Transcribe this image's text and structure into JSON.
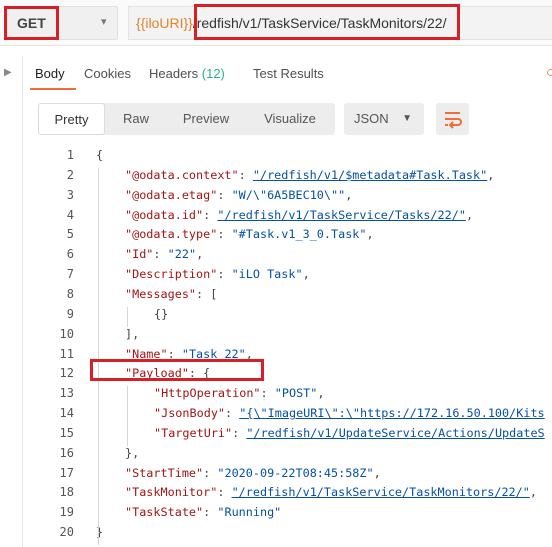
{
  "request": {
    "method": "GET",
    "url_variable": "{{iloURI}}",
    "url_path": "/redfish/v1/TaskService/TaskMonitors/22/"
  },
  "tabs": [
    {
      "label": "Body"
    },
    {
      "label": "Cookies"
    },
    {
      "label": "Headers",
      "count": "(12)"
    },
    {
      "label": "Test Results"
    }
  ],
  "format_buttons": [
    "Pretty",
    "Raw",
    "Preview",
    "Visualize"
  ],
  "language": "JSON",
  "colors": {
    "accent": "#f26b3a",
    "highlight": "#d81f26",
    "key": "#a31515",
    "string": "#0451a5"
  },
  "code_lines": [
    {
      "n": "1",
      "parts": [
        {
          "t": "{",
          "c": "p"
        }
      ]
    },
    {
      "n": "2",
      "parts": [
        {
          "t": "\"@odata.context\"",
          "c": "k"
        },
        {
          "t": ": ",
          "c": "p"
        },
        {
          "t": "\"/redfish/v1/$metadata#Task.Task\"",
          "c": "s u"
        },
        {
          "t": ",",
          "c": "p"
        }
      ]
    },
    {
      "n": "3",
      "parts": [
        {
          "t": "\"@odata.etag\"",
          "c": "k"
        },
        {
          "t": ": ",
          "c": "p"
        },
        {
          "t": "\"W/\\\"6A5BEC10\\\"\"",
          "c": "s"
        },
        {
          "t": ",",
          "c": "p"
        }
      ]
    },
    {
      "n": "4",
      "parts": [
        {
          "t": "\"@odata.id\"",
          "c": "k"
        },
        {
          "t": ": ",
          "c": "p"
        },
        {
          "t": "\"/redfish/v1/TaskService/Tasks/22/\"",
          "c": "s u"
        },
        {
          "t": ",",
          "c": "p"
        }
      ]
    },
    {
      "n": "5",
      "parts": [
        {
          "t": "\"@odata.type\"",
          "c": "k"
        },
        {
          "t": ": ",
          "c": "p"
        },
        {
          "t": "\"#Task.v1_3_0.Task\"",
          "c": "s"
        },
        {
          "t": ",",
          "c": "p"
        }
      ]
    },
    {
      "n": "6",
      "parts": [
        {
          "t": "\"Id\"",
          "c": "k"
        },
        {
          "t": ": ",
          "c": "p"
        },
        {
          "t": "\"22\"",
          "c": "s"
        },
        {
          "t": ",",
          "c": "p"
        }
      ]
    },
    {
      "n": "7",
      "parts": [
        {
          "t": "\"Description\"",
          "c": "k"
        },
        {
          "t": ": ",
          "c": "p"
        },
        {
          "t": "\"iLO Task\"",
          "c": "s"
        },
        {
          "t": ",",
          "c": "p"
        }
      ]
    },
    {
      "n": "8",
      "parts": [
        {
          "t": "\"Messages\"",
          "c": "k"
        },
        {
          "t": ": [",
          "c": "p"
        }
      ]
    },
    {
      "n": "9",
      "parts": [
        {
          "t": "{}",
          "c": "p"
        }
      ]
    },
    {
      "n": "10",
      "parts": [
        {
          "t": "],",
          "c": "p"
        }
      ]
    },
    {
      "n": "11",
      "parts": [
        {
          "t": "\"Name\"",
          "c": "k"
        },
        {
          "t": ": ",
          "c": "p"
        },
        {
          "t": "\"Task 22\"",
          "c": "s"
        },
        {
          "t": ",",
          "c": "p"
        }
      ]
    },
    {
      "n": "12",
      "parts": [
        {
          "t": "\"Payload\"",
          "c": "k"
        },
        {
          "t": ": {",
          "c": "p"
        }
      ]
    },
    {
      "n": "13",
      "parts": [
        {
          "t": "\"HttpOperation\"",
          "c": "k"
        },
        {
          "t": ": ",
          "c": "p"
        },
        {
          "t": "\"POST\"",
          "c": "s"
        },
        {
          "t": ",",
          "c": "p"
        }
      ]
    },
    {
      "n": "14",
      "parts": [
        {
          "t": "\"JsonBody\"",
          "c": "k"
        },
        {
          "t": ": ",
          "c": "p"
        },
        {
          "t": "\"{\\\"ImageURI\\\":\\\"https://172.16.50.100/Kits",
          "c": "s u"
        }
      ]
    },
    {
      "n": "15",
      "parts": [
        {
          "t": "\"TargetUri\"",
          "c": "k"
        },
        {
          "t": ": ",
          "c": "p"
        },
        {
          "t": "\"/redfish/v1/UpdateService/Actions/UpdateS",
          "c": "s u"
        }
      ]
    },
    {
      "n": "16",
      "parts": [
        {
          "t": "},",
          "c": "p"
        }
      ]
    },
    {
      "n": "17",
      "parts": [
        {
          "t": "\"StartTime\"",
          "c": "k"
        },
        {
          "t": ": ",
          "c": "p"
        },
        {
          "t": "\"2020-09-22T08:45:58Z\"",
          "c": "s"
        },
        {
          "t": ",",
          "c": "p"
        }
      ]
    },
    {
      "n": "18",
      "parts": [
        {
          "t": "\"TaskMonitor\"",
          "c": "k"
        },
        {
          "t": ": ",
          "c": "p"
        },
        {
          "t": "\"/redfish/v1/TaskService/TaskMonitors/22/\"",
          "c": "s u"
        },
        {
          "t": ",",
          "c": "p"
        }
      ]
    },
    {
      "n": "19",
      "parts": [
        {
          "t": "\"TaskState\"",
          "c": "k"
        },
        {
          "t": ": ",
          "c": "p"
        },
        {
          "t": "\"Running\"",
          "c": "s"
        }
      ]
    },
    {
      "n": "20",
      "parts": [
        {
          "t": "}",
          "c": "p"
        }
      ]
    }
  ]
}
